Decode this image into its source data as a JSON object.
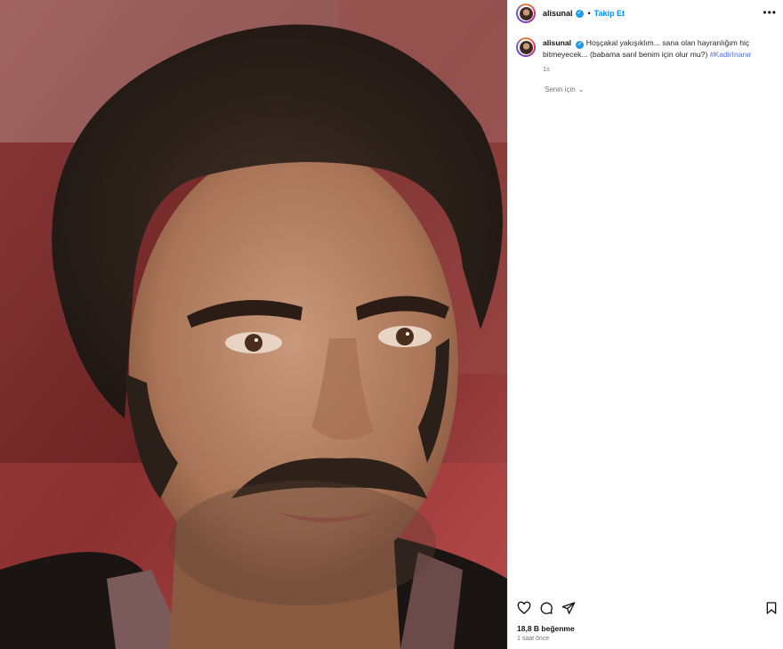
{
  "post": {
    "username": "alisunal",
    "follow_label": "Takip Et",
    "separator": "•",
    "more_label": "•••",
    "caption": {
      "username": "alisunal",
      "text": "Hoşçakal yakışıklım... sana olan hayranlığım hiç bitmeyecek... (babama sarıl benim için olur mu?)",
      "hashtag": "#KadirInanır",
      "time": "1s"
    },
    "translation_label": "Senin için",
    "likes": "18,8 B beğenme",
    "posted_ago": "1 saat önce"
  },
  "icons": {
    "verified": "verified-badge-icon",
    "like": "heart-icon",
    "comment": "comment-bubble-icon",
    "share": "paper-plane-icon",
    "save": "bookmark-icon",
    "more": "more-options-icon",
    "chevron": "chevron-down-icon"
  },
  "colors": {
    "follow": "#0095f6",
    "verified": "#1d9bf0",
    "hashtag": "#4b6ee8",
    "muted": "#737373"
  }
}
